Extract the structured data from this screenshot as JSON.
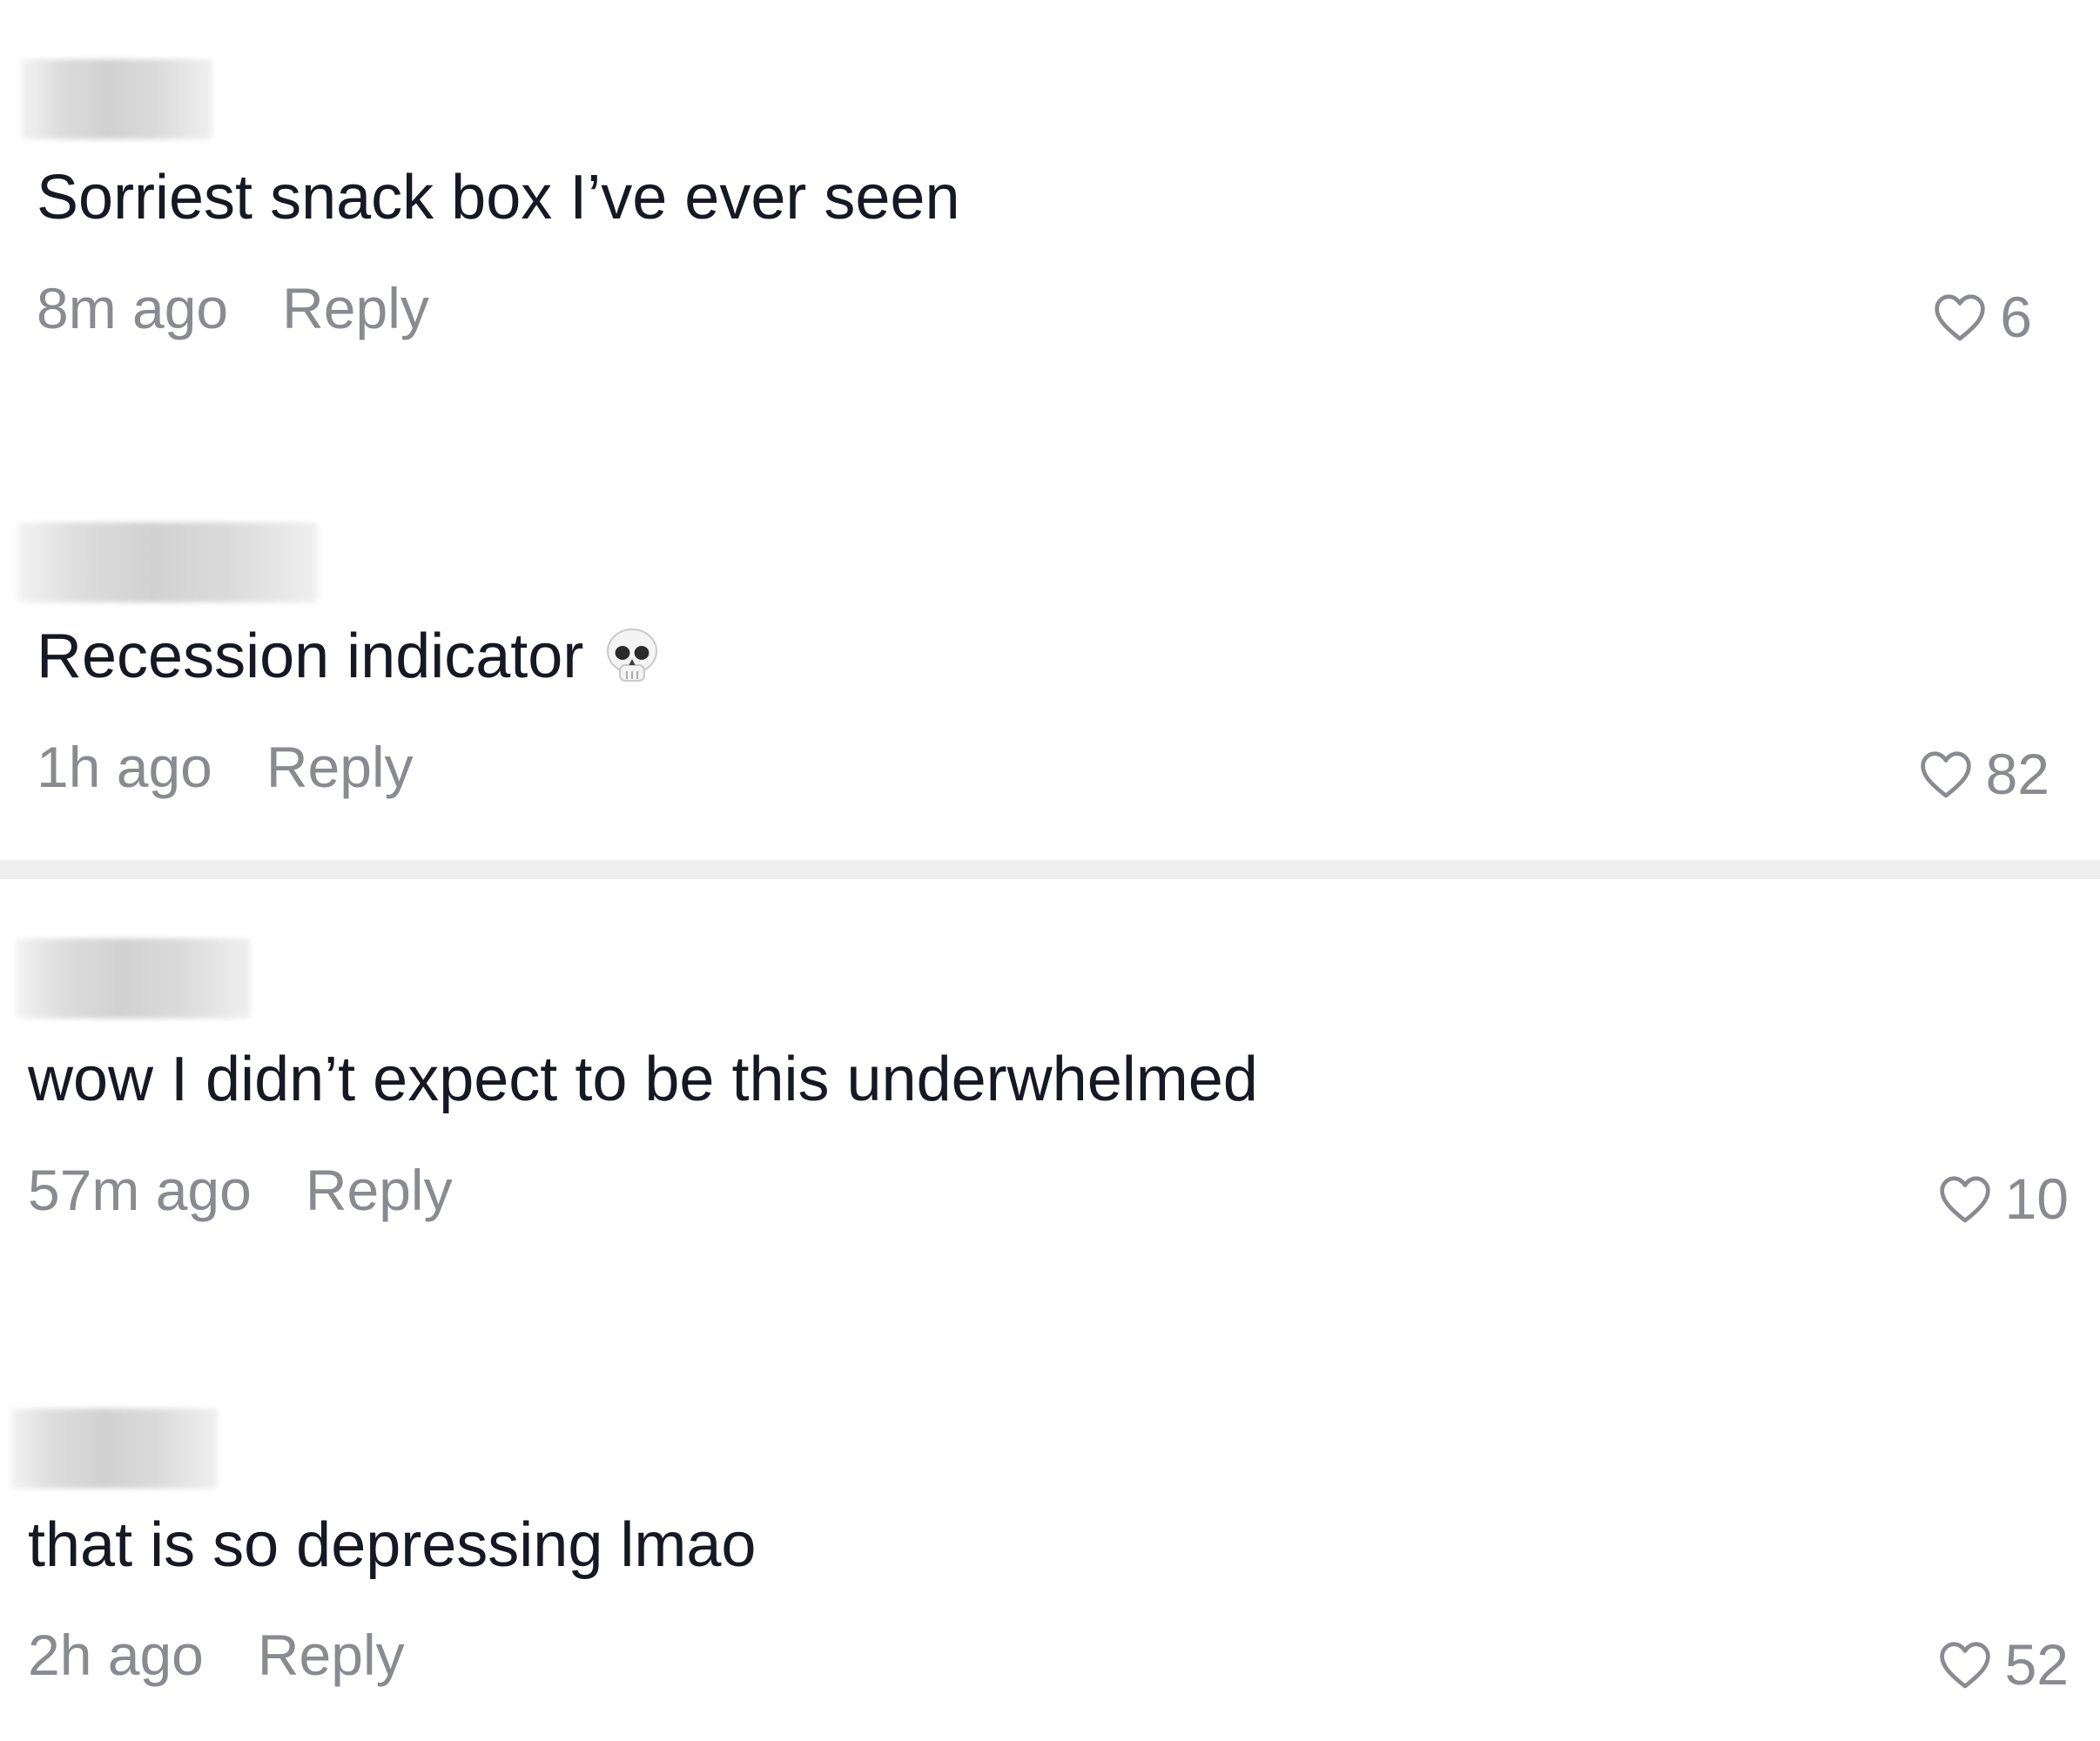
{
  "comments": [
    {
      "text": "Sorriest snack box I’ve ever seen",
      "time": "8m ago",
      "reply_label": "Reply",
      "likes": "6",
      "emoji": ""
    },
    {
      "text": "Recession indicator",
      "time": "1h ago",
      "reply_label": "Reply",
      "likes": "82",
      "emoji": "skull-icon"
    },
    {
      "text": "wow I didn’t expect to be this underwhelmed",
      "time": "57m ago",
      "reply_label": "Reply",
      "likes": "10",
      "emoji": ""
    },
    {
      "text": "that is so depressing lmao",
      "time": "2h ago",
      "reply_label": "Reply",
      "likes": "52",
      "emoji": ""
    }
  ],
  "colors": {
    "text": "#161823",
    "meta": "#8a8b91",
    "divider": "#eeeeee"
  }
}
